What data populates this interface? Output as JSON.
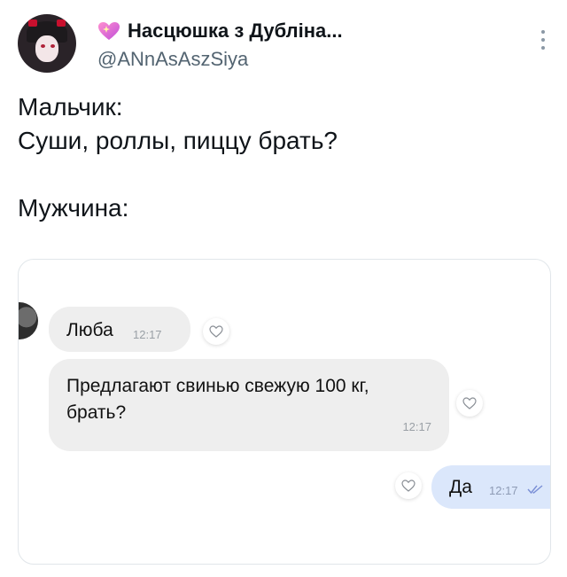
{
  "tweet": {
    "display_name": "Насцюшка з Дублiна...",
    "handle": "@ANnAsAszSiya",
    "lines": [
      "Мальчик:",
      "Суши, роллы, пиццу брать?",
      "",
      "Мужчина:"
    ]
  },
  "chat": {
    "messages": [
      {
        "text": "Люба",
        "time": "12:17",
        "direction": "incoming"
      },
      {
        "text": "Предлагают свинью свежую 100 кг, брать?",
        "time": "12:17",
        "direction": "incoming"
      },
      {
        "text": "Да",
        "time": "12:17",
        "direction": "outgoing",
        "status": "read"
      }
    ]
  },
  "colors": {
    "incoming_bubble": "#eeeeee",
    "outgoing_bubble": "#dbe7fb",
    "handle_text": "#536471",
    "read_check": "#7a8fd6"
  },
  "icons": [
    "heart-icon",
    "more-icon",
    "reaction-heart-icon",
    "double-check-icon"
  ]
}
